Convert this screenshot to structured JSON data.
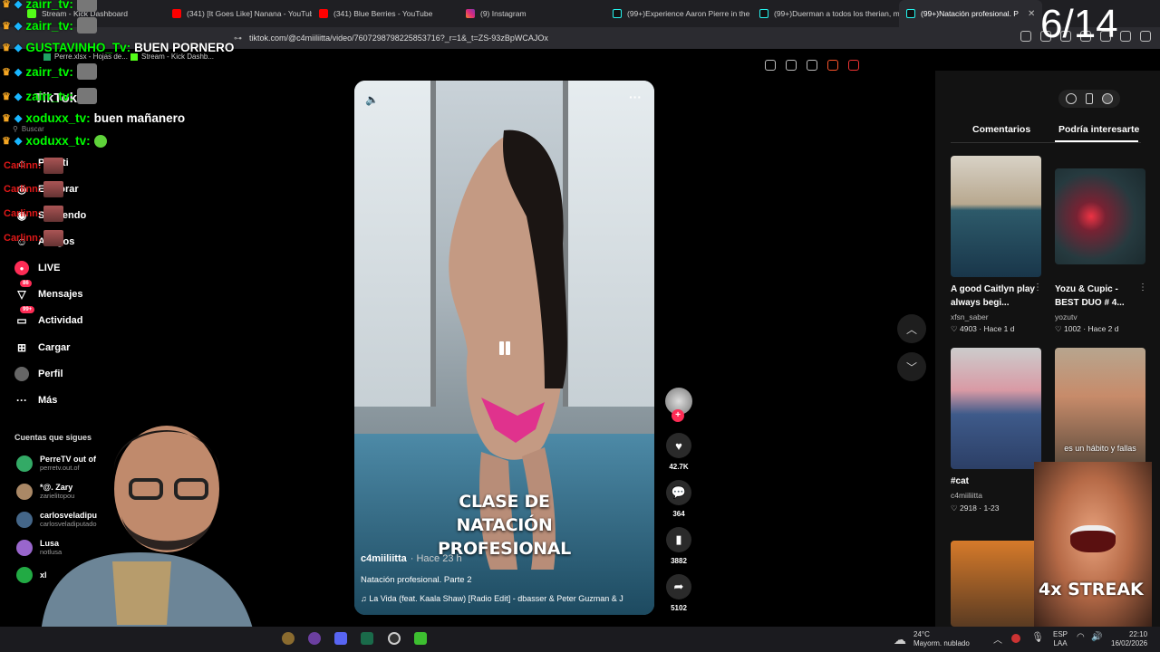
{
  "browser": {
    "tabs": [
      {
        "label": "Stream - Kick Dashboard",
        "icon": "kick-icon"
      },
      {
        "label": "(341) [It Goes Like] Nanana - YouTube",
        "icon": "youtube-icon"
      },
      {
        "label": "(341) Blue Berries - YouTube",
        "icon": "youtube-icon"
      },
      {
        "label": "(9) Instagram",
        "icon": "instagram-icon"
      },
      {
        "label": "(99+)Experience Aaron Pierre in the",
        "icon": "tiktok-icon"
      },
      {
        "label": "(99+)Duerman a todos los therian, m",
        "icon": "tiktok-icon"
      },
      {
        "label": "(99+)Natación profesional. P",
        "icon": "tiktok-icon"
      }
    ],
    "url": "tiktok.com/@c4miiliitta/video/7607298798225853716?_r=1&_t=ZS-93zBpWCAJOx",
    "bookmarks": [
      "Perre.xlsx - Hojas de...",
      "Stream - Kick Dashb..."
    ]
  },
  "overlay": {
    "counter": "6/14",
    "chat": [
      {
        "user": "zairr_tv:",
        "msg": ""
      },
      {
        "user": "zairr_tv:",
        "msg": ""
      },
      {
        "user": "GUSTAVINHO_Tv:",
        "msg": "BUEN PORNERO"
      },
      {
        "user": "zairr_tv:",
        "msg": ""
      },
      {
        "user": "zairr_tv:",
        "msg": ""
      },
      {
        "user": "xoduxx_tv:",
        "msg": "buen mañanero"
      },
      {
        "user": "xoduxx_tv:",
        "msg": ""
      }
    ],
    "mini_chat": [
      "Carlinn:",
      "Carlinn:",
      "Carlinn:",
      "Carlinn:"
    ],
    "streak": "4x STREAK"
  },
  "sidebar": {
    "logo": "TikTok",
    "search_placeholder": "Buscar",
    "items": [
      {
        "label": "Para ti",
        "icon": "home-icon"
      },
      {
        "label": "Explorar",
        "icon": "compass-icon"
      },
      {
        "label": "Siguiendo",
        "icon": "following-icon"
      },
      {
        "label": "Amigos",
        "icon": "friends-icon"
      },
      {
        "label": "LIVE",
        "icon": "live-icon"
      },
      {
        "label": "Mensajes",
        "icon": "messages-icon",
        "badge": "86"
      },
      {
        "label": "Actividad",
        "icon": "activity-icon",
        "badge": "99+"
      },
      {
        "label": "Cargar",
        "icon": "upload-icon"
      },
      {
        "label": "Perfil",
        "icon": "profile-icon"
      },
      {
        "label": "Más",
        "icon": "more-icon"
      }
    ],
    "following_title": "Cuentas que sigues",
    "following": [
      {
        "name": "PerreTV out of",
        "handle": "perretv.out.of"
      },
      {
        "name": "*@. Zary",
        "handle": "zarielitopou"
      },
      {
        "name": "carlosveladipu",
        "handle": "carlosveladiputado"
      },
      {
        "name": "Lusa",
        "handle": "notlusa"
      },
      {
        "name": "xl",
        "handle": ""
      }
    ]
  },
  "video": {
    "caption": "CLASE DE NATACIÓN PROFESIONAL",
    "username": "c4miiliitta",
    "time": "· Hace 23 h",
    "description": "Natación profesional. Parte 2",
    "music": "La Vida (feat. Kaala Shaw) [Radio Edit] - dbasser & Peter Guzman & J",
    "likes": "42.7K",
    "comments": "364",
    "saves": "3882",
    "shares": "5102"
  },
  "right_panel": {
    "tabs": [
      "Comentarios",
      "Podría interesarte"
    ],
    "cards": [
      {
        "title": "A good Caitlyn play always begi...",
        "user": "xfsn_saber",
        "likes": "4903",
        "time": "Hace 1 d"
      },
      {
        "title": "Yozu & Cupic - BEST DUO # 4...",
        "user": "yozutv",
        "likes": "1002",
        "time": "Hace 2 d"
      },
      {
        "title": "#cat",
        "user": "c4miiliitta",
        "likes": "2918",
        "time": "1-23"
      },
      {
        "title": "",
        "user": "",
        "likes": "",
        "time": "",
        "overlay_text": "es un hábito y fallas"
      }
    ]
  },
  "taskbar": {
    "weather_temp": "24°C",
    "weather_desc": "Mayorm. nublado",
    "lang": "ESP",
    "lang2": "LAA",
    "time": "22:10",
    "date": "16/02/2026"
  }
}
